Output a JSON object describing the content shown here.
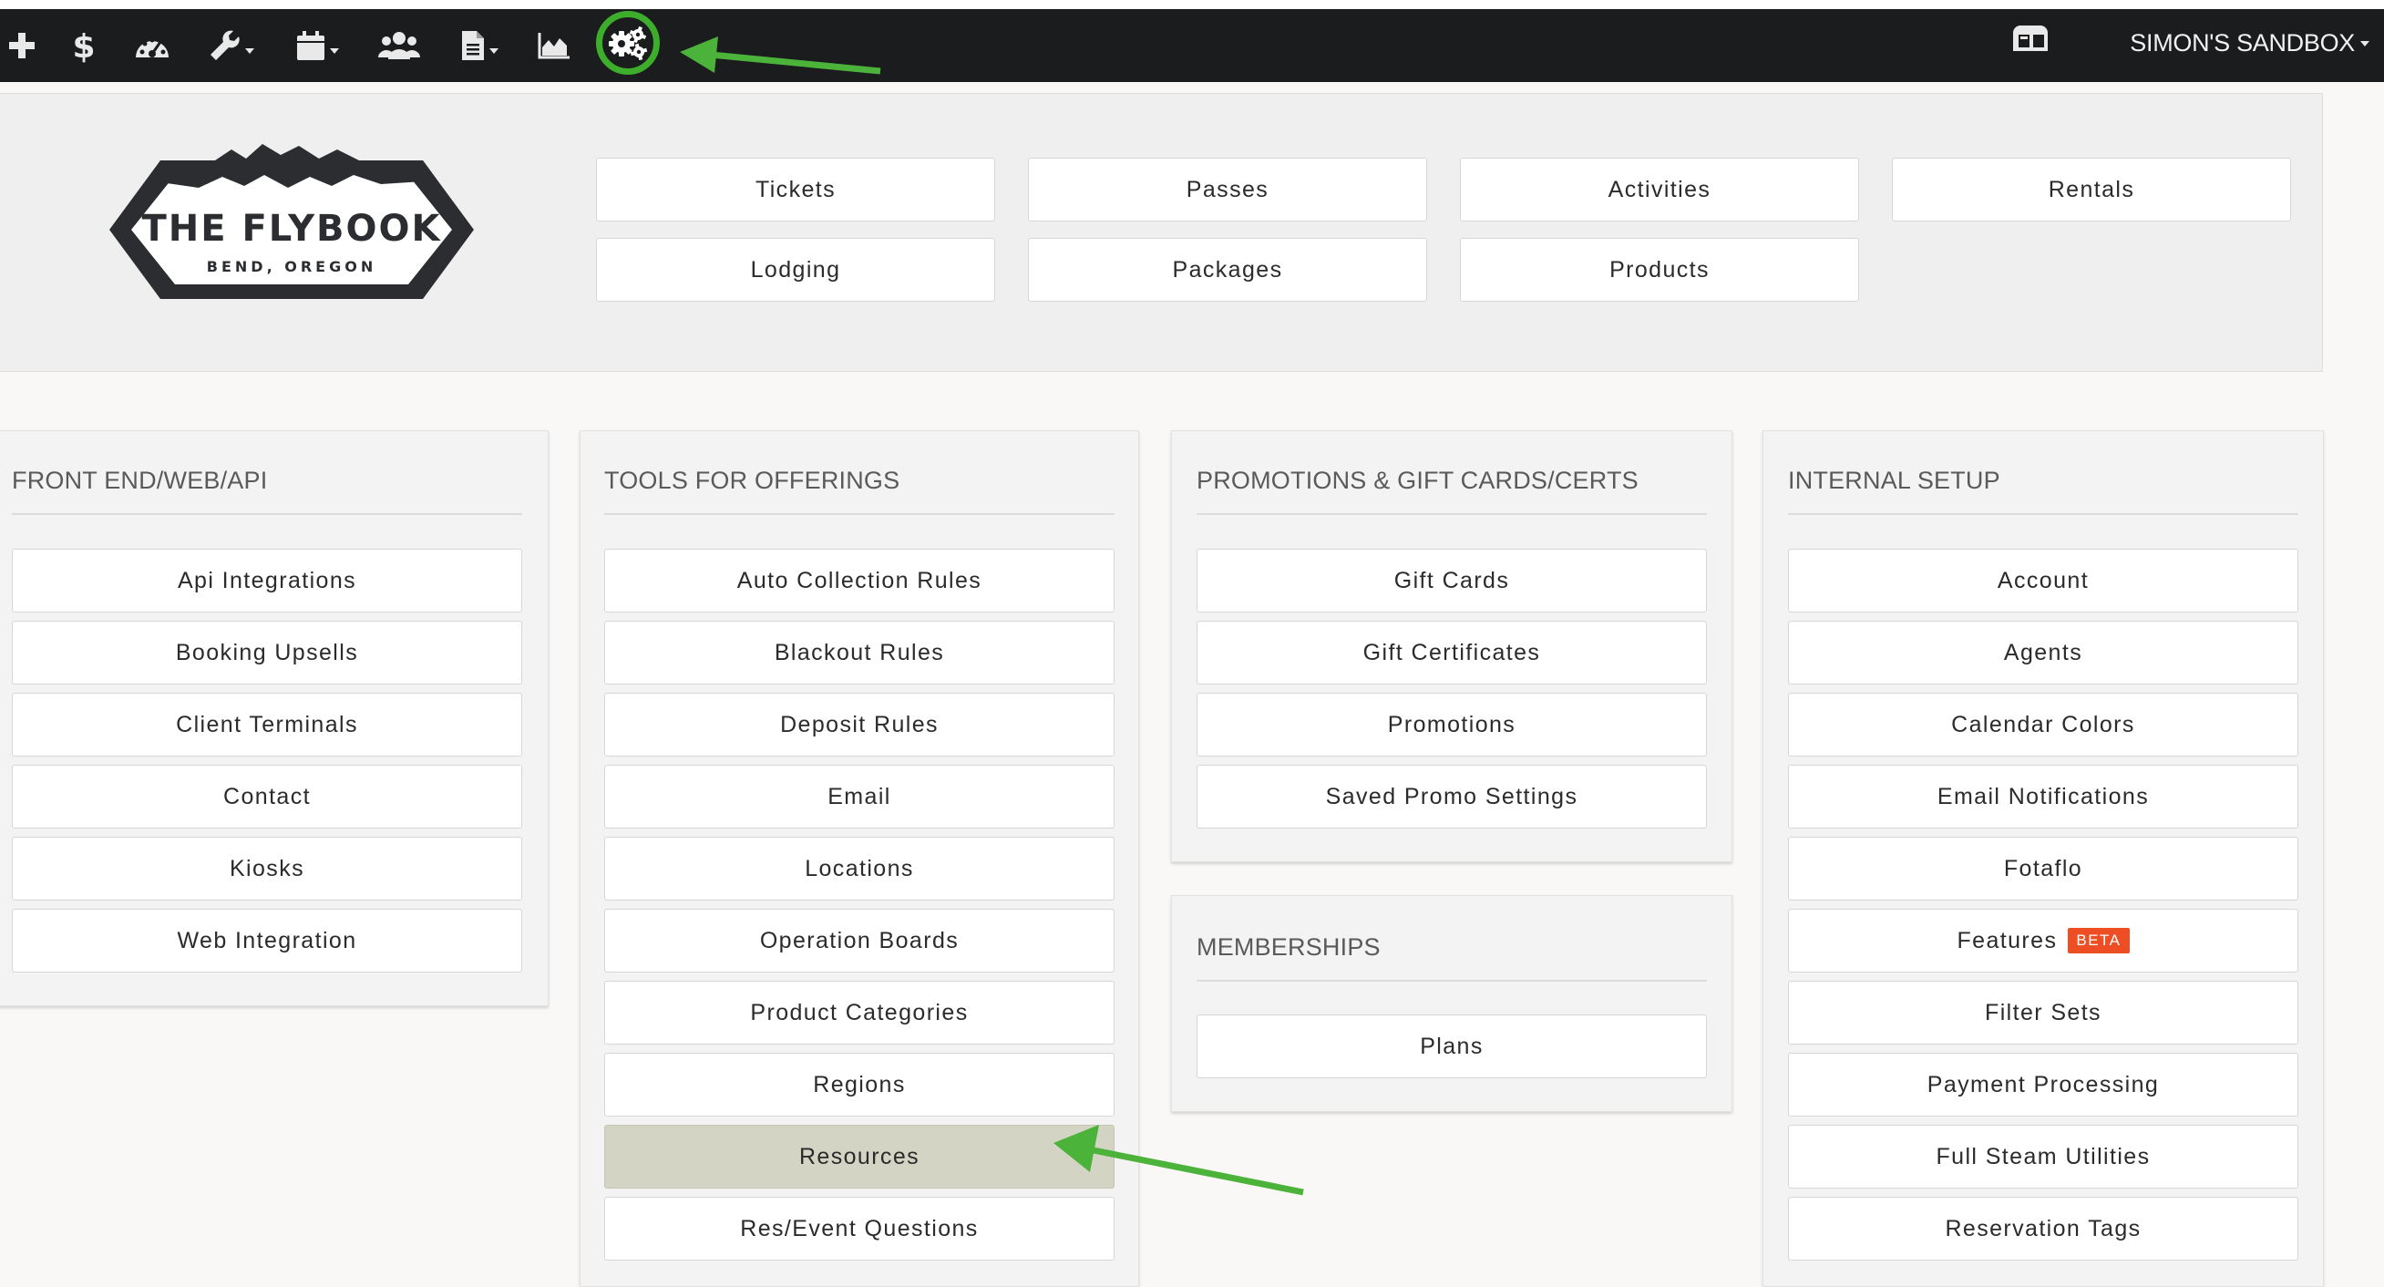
{
  "navbar": {
    "account_name": "SIMON'S SANDBOX",
    "icons": [
      "plus-icon",
      "dollar-icon",
      "dashboard-icon",
      "wrench-icon",
      "calendar-icon",
      "users-icon",
      "document-icon",
      "area-chart-icon",
      "settings-cogs-icon",
      "card-reader-icon"
    ]
  },
  "logo": {
    "title": "THE FLYBOOK",
    "subtitle": "BEND, OREGON"
  },
  "offerings": {
    "row1": [
      "Tickets",
      "Passes",
      "Activities",
      "Rentals"
    ],
    "row2": [
      "Lodging",
      "Packages",
      "Products"
    ]
  },
  "sections": {
    "front_end": {
      "title": "FRONT END/WEB/API",
      "items": [
        "Api Integrations",
        "Booking Upsells",
        "Client Terminals",
        "Contact",
        "Kiosks",
        "Web Integration"
      ]
    },
    "tools": {
      "title": "TOOLS FOR OFFERINGS",
      "items": [
        "Auto Collection Rules",
        "Blackout Rules",
        "Deposit Rules",
        "Email",
        "Locations",
        "Operation Boards",
        "Product Categories",
        "Regions",
        "Resources",
        "Res/Event Questions"
      ]
    },
    "promotions": {
      "title": "PROMOTIONS & GIFT CARDS/CERTS",
      "items": [
        "Gift Cards",
        "Gift Certificates",
        "Promotions",
        "Saved Promo Settings"
      ]
    },
    "memberships": {
      "title": "MEMBERSHIPS",
      "items": [
        "Plans"
      ]
    },
    "internal": {
      "title": "INTERNAL SETUP",
      "items": [
        "Account",
        "Agents",
        "Calendar Colors",
        "Email Notifications",
        "Fotaflo",
        "Features",
        "Filter Sets",
        "Payment Processing",
        "Full Steam Utilities",
        "Reservation Tags"
      ],
      "features_badge": "BETA"
    }
  },
  "colors": {
    "navbar": "#1b1c1e",
    "highlight_ring": "#3dae2b",
    "arrow": "#4cb33a",
    "beta_badge": "#ed4e23",
    "selected_button": "#d3d4c3"
  }
}
